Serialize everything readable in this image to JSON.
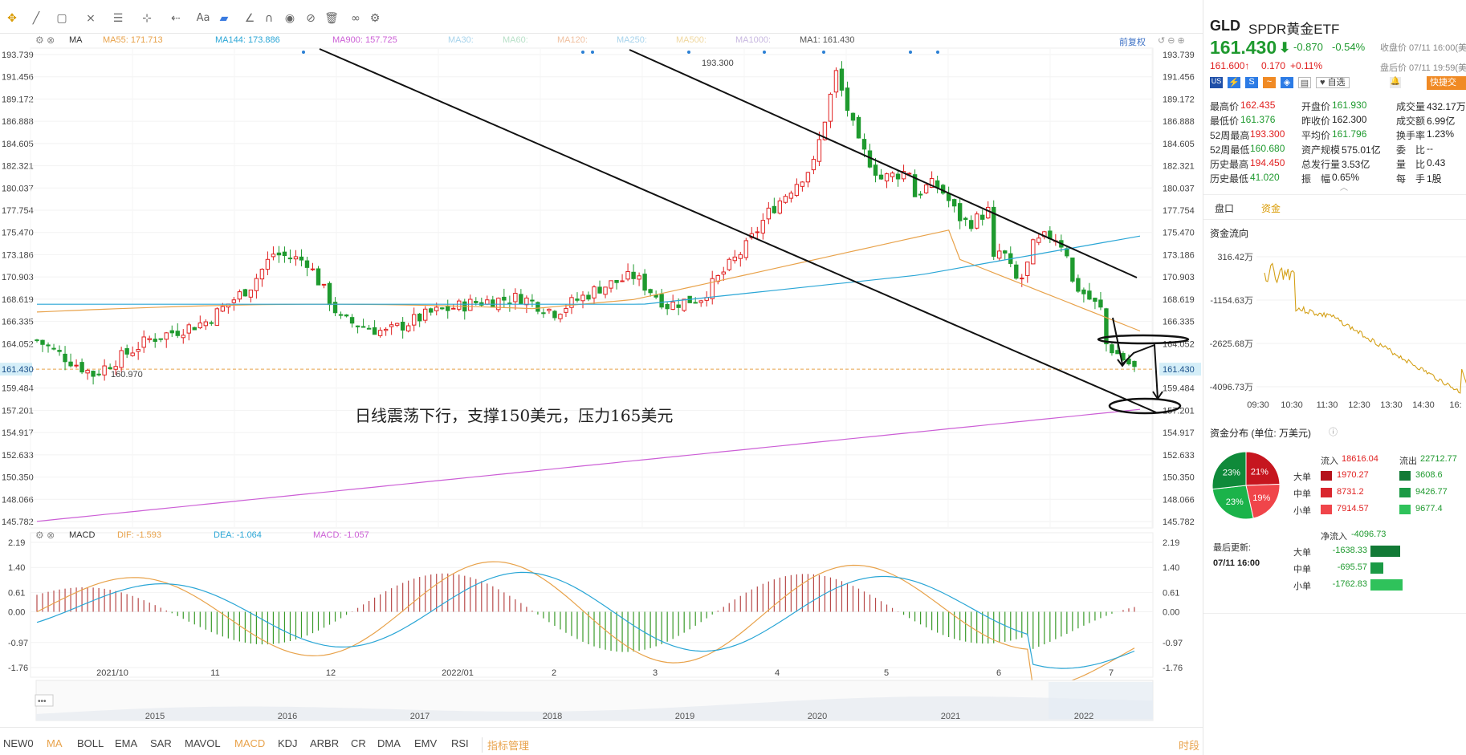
{
  "toolbar": {
    "icons": [
      "crosshair-icon",
      "line-icon",
      "shape-icon",
      "fib-icon",
      "channel-icon",
      "measure-icon",
      "arrow-icon",
      "text-icon",
      "comment-icon",
      "ruler-icon",
      "magnet-icon",
      "eye-icon",
      "hide-icon",
      "trash-icon",
      "link-icon",
      "settings-icon"
    ],
    "text_label": "Aa"
  },
  "ma_legend": {
    "ma_label": "MA",
    "ma55": "MA55: 171.713",
    "ma144": "MA144: 173.886",
    "ma900": "MA900: 157.725",
    "ma30": "MA30:",
    "ma60": "MA60:",
    "ma120": "MA120:",
    "ma250": "MA250:",
    "ma500": "MA500:",
    "ma1000": "MA1000:",
    "ma1": "MA1: 161.430",
    "adjust": "前复权"
  },
  "macd_legend": {
    "label": "MACD",
    "dif": "DIF: -1.593",
    "dea": "DEA: -1.064",
    "macd": "MACD: -1.057"
  },
  "price_axis": [
    "193.739",
    "191.456",
    "189.172",
    "186.888",
    "184.605",
    "182.321",
    "180.037",
    "177.754",
    "175.470",
    "173.186",
    "170.903",
    "168.619",
    "166.335",
    "164.052",
    "161.430",
    "159.484",
    "157.201",
    "154.917",
    "152.633",
    "150.350",
    "148.066",
    "145.782"
  ],
  "macd_axis": [
    "2.19",
    "1.40",
    "0.61",
    "0.00",
    "-0.97",
    "-1.76"
  ],
  "time_axis": [
    "2021/10",
    "11",
    "12",
    "2022/01",
    "2",
    "3",
    "4",
    "5",
    "6",
    "7"
  ],
  "overview_years": [
    "2015",
    "2016",
    "2017",
    "2018",
    "2019",
    "2020",
    "2021",
    "2022"
  ],
  "annotations": {
    "high_label": "193.300",
    "low_label": "160.970",
    "current_price": "161.430",
    "comment": "日线震荡下行，支撑150美元，压力165美元"
  },
  "bottom_indicators": [
    "NEW0",
    "MA",
    "BOLL",
    "EMA",
    "SAR",
    "MAVOL",
    "MACD",
    "KDJ",
    "ARBR",
    "CR",
    "DMA",
    "EMV",
    "RSI",
    "指标管理"
  ],
  "bottom_right": "时段",
  "quote": {
    "symbol": "GLD",
    "name": "SPDR黄金ETF",
    "price": "161.430",
    "arrow": "⬇",
    "change": "-0.870",
    "pct": "-0.54%",
    "close_time": "收盘价 07/11 16:00(美",
    "after_price": "161.600↑",
    "after_change": "0.170",
    "after_pct": "+0.11%",
    "after_time": "盘后价 07/11 19:59(美",
    "watch": "自选",
    "quick_trade": "快捷交"
  },
  "stats": [
    [
      {
        "k": "最高价",
        "v": "162.435",
        "c": "red"
      },
      {
        "k": "开盘价",
        "v": "161.930",
        "c": "green"
      },
      {
        "k": "成交量",
        "v": "432.17万",
        "c": "dark"
      }
    ],
    [
      {
        "k": "最低价",
        "v": "161.376",
        "c": "green"
      },
      {
        "k": "昨收价",
        "v": "162.300",
        "c": "dark"
      },
      {
        "k": "成交额",
        "v": "6.99亿",
        "c": "dark"
      }
    ],
    [
      {
        "k": "52周最高",
        "v": "193.300",
        "c": "red"
      },
      {
        "k": "平均价",
        "v": "161.796",
        "c": "green"
      },
      {
        "k": "换手率",
        "v": "1.23%",
        "c": "dark"
      }
    ],
    [
      {
        "k": "52周最低",
        "v": "160.680",
        "c": "green"
      },
      {
        "k": "资产规模",
        "v": "575.01亿",
        "c": "dark"
      },
      {
        "k": "委　比",
        "v": "--",
        "c": "dark"
      }
    ],
    [
      {
        "k": "历史最高",
        "v": "194.450",
        "c": "red"
      },
      {
        "k": "总发行量",
        "v": "3.53亿",
        "c": "dark"
      },
      {
        "k": "量　比",
        "v": "0.43",
        "c": "dark"
      }
    ],
    [
      {
        "k": "历史最低",
        "v": "41.020",
        "c": "green"
      },
      {
        "k": "振　幅",
        "v": "0.65%",
        "c": "dark"
      },
      {
        "k": "每　手",
        "v": "1股",
        "c": "dark"
      }
    ]
  ],
  "tabs": [
    "盘口",
    "资金"
  ],
  "flow": {
    "title": "资金流向",
    "yaxis": [
      "316.42万",
      "-1154.63万",
      "-2625.68万",
      "-4096.73万"
    ],
    "xaxis": [
      "09:30",
      "10:30",
      "11:30",
      "12:30",
      "13:30",
      "14:30",
      "16:"
    ]
  },
  "distribution": {
    "title": "资金分布 (单位: 万美元)",
    "pie": [
      {
        "label": "21%",
        "value": 21,
        "color": "#c6161f"
      },
      {
        "label": "19%",
        "value": 19,
        "color": "#f0454a"
      },
      {
        "label": "23%",
        "value": 23,
        "color": "#1bb34a"
      },
      {
        "label": "23%",
        "value": 23,
        "color": "#0f8a3a"
      }
    ],
    "in_label": "流入",
    "in_total": "18616.04",
    "out_label": "流出",
    "out_total": "22712.77",
    "rows": [
      {
        "name": "大单",
        "in": "1970.27",
        "out": "3608.6",
        "in_color": "#b5121b",
        "out_color": "#127a36"
      },
      {
        "name": "中单",
        "in": "8731.2",
        "out": "9426.77",
        "in_color": "#d9262e",
        "out_color": "#1b9a45"
      },
      {
        "name": "小单",
        "in": "7914.57",
        "out": "9677.4",
        "in_color": "#f0454a",
        "out_color": "#2fc25b"
      }
    ],
    "updated_label": "最后更新:",
    "updated_time": "07/11 16:00",
    "net_label": "净流入",
    "net_total": "-4096.73",
    "net_rows": [
      {
        "name": "大单",
        "value": "-1638.33",
        "ratio": 0.93
      },
      {
        "name": "中单",
        "value": "-695.57",
        "ratio": 0.39
      },
      {
        "name": "小单",
        "value": "-1762.83",
        "ratio": 1.0
      }
    ]
  },
  "colors": {
    "up": "#e02020",
    "down": "#1f9a2f",
    "ma55": "#e8a24a",
    "ma144": "#2aa6d6",
    "ma900": "#cc5fd6",
    "dif": "#e8a24a",
    "dea": "#2aa6d6"
  }
}
